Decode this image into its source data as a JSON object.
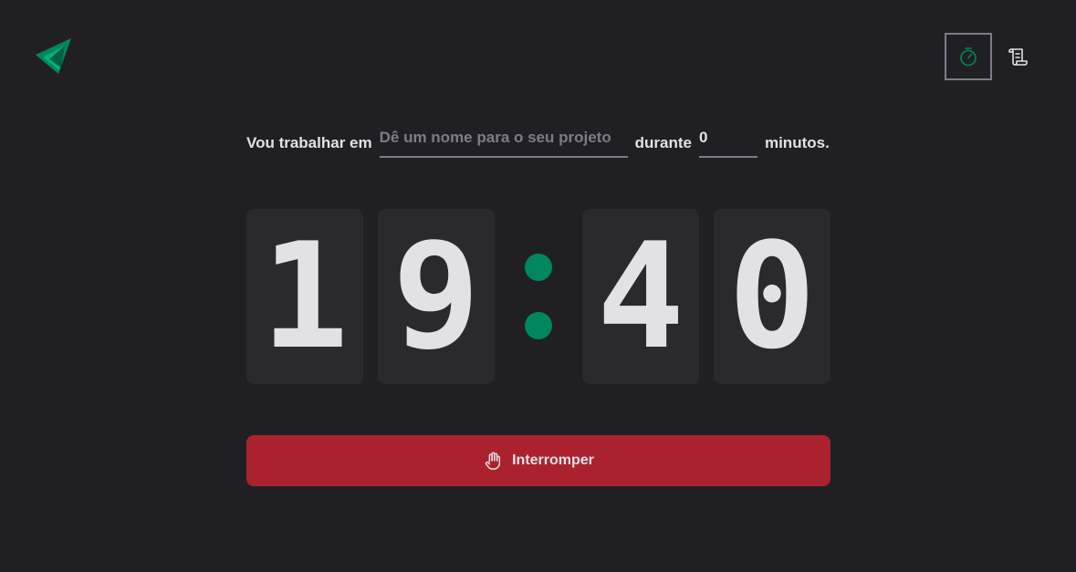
{
  "colors": {
    "background": "#202024",
    "card": "#29292e",
    "accent": "#00875f",
    "danger": "#ab222e",
    "text": "#e1e1e6",
    "muted": "#7c7c8a"
  },
  "header": {
    "logo_icon": "ignite-logo-icon",
    "nav": [
      {
        "icon": "timer-icon",
        "active": true
      },
      {
        "icon": "scroll-icon",
        "active": false
      }
    ]
  },
  "form": {
    "label_work": "Vou trabalhar em",
    "task_placeholder": "Dê um nome para o seu projeto",
    "label_during": "durante",
    "minutes_value": "0",
    "label_minutes": "minutos."
  },
  "countdown": {
    "minutes_tens": "1",
    "minutes_ones": "9",
    "seconds_tens": "4",
    "seconds_ones": "0"
  },
  "stop_button": {
    "label": "Interromper",
    "icon": "hand-palm-icon"
  }
}
